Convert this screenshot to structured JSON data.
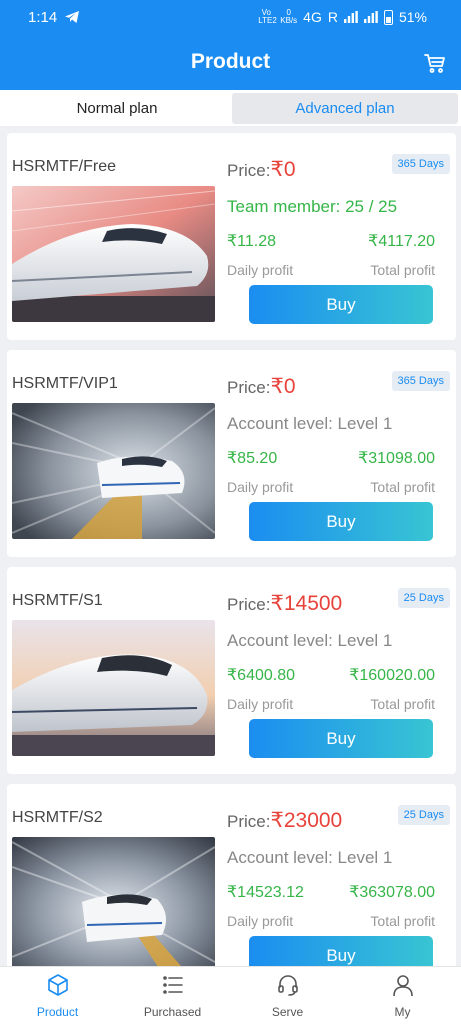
{
  "status_bar": {
    "time": "1:14",
    "volte": "Vo LTE2",
    "speed_value": "0",
    "speed_unit": "KB/s",
    "network": "4G",
    "roaming": "R",
    "battery": "51%"
  },
  "header": {
    "title": "Product",
    "cart_icon": "cart-icon"
  },
  "plan_tabs": [
    {
      "label": "Normal plan",
      "active": false
    },
    {
      "label": "Advanced plan",
      "active": true
    }
  ],
  "products": [
    {
      "name": "HSRMTF/Free",
      "price_label": "Price:",
      "price": "₹0",
      "days": "365 Days",
      "extra_text": "Team member: 25 / 25",
      "extra_kind": "team",
      "daily_profit": "₹11.28",
      "total_profit": "₹4117.20",
      "daily_label": "Daily profit",
      "total_label": "Total profit",
      "buy_label": "Buy"
    },
    {
      "name": "HSRMTF/VIP1",
      "price_label": "Price:",
      "price": "₹0",
      "days": "365 Days",
      "extra_text": "Account level: Level 1",
      "extra_kind": "level",
      "daily_profit": "₹85.20",
      "total_profit": "₹31098.00",
      "daily_label": "Daily profit",
      "total_label": "Total profit",
      "buy_label": "Buy"
    },
    {
      "name": "HSRMTF/S1",
      "price_label": "Price:",
      "price": "₹14500",
      "days": "25 Days",
      "extra_text": "Account level: Level 1",
      "extra_kind": "level",
      "daily_profit": "₹6400.80",
      "total_profit": "₹160020.00",
      "daily_label": "Daily profit",
      "total_label": "Total profit",
      "buy_label": "Buy"
    },
    {
      "name": "HSRMTF/S2",
      "price_label": "Price:",
      "price": "₹23000",
      "days": "25 Days",
      "extra_text": "Account level: Level 1",
      "extra_kind": "level",
      "daily_profit": "₹14523.12",
      "total_profit": "₹363078.00",
      "daily_label": "Daily profit",
      "total_label": "Total profit",
      "buy_label": "Buy"
    }
  ],
  "bottom_nav": [
    {
      "label": "Product",
      "icon": "cube-icon",
      "active": true
    },
    {
      "label": "Purchased",
      "icon": "list-icon",
      "active": false
    },
    {
      "label": "Serve",
      "icon": "headset-icon",
      "active": false
    },
    {
      "label": "My",
      "icon": "user-icon",
      "active": false
    }
  ],
  "colors": {
    "brand": "#1a8cf2",
    "price": "#e8433b",
    "profit": "#36b548"
  }
}
